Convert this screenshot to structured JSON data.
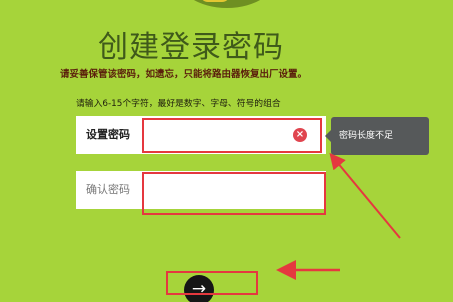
{
  "page": {
    "title": "创建登录密码",
    "warning": "请妥善保管该密码，如遗忘，只能将路由器恢复出厂设置。",
    "hint": "请输入6-15个字符，最好是数字、字母、符号的组合"
  },
  "password_field": {
    "label": "设置密码",
    "value": "",
    "clear_icon": "×",
    "icon_name": "clear-icon"
  },
  "confirm_field": {
    "label": "确认密码",
    "value": ""
  },
  "tooltip": {
    "text": "密码长度不足"
  },
  "submit": {
    "icon": "→",
    "icon_name": "arrow-right-icon"
  },
  "colors": {
    "background": "#a6d43a",
    "title": "#3f5a1a",
    "warning": "#5b1f0c",
    "annotation": "#e5383f",
    "tooltip": "#56595a",
    "clear_icon": "#e0454f"
  }
}
